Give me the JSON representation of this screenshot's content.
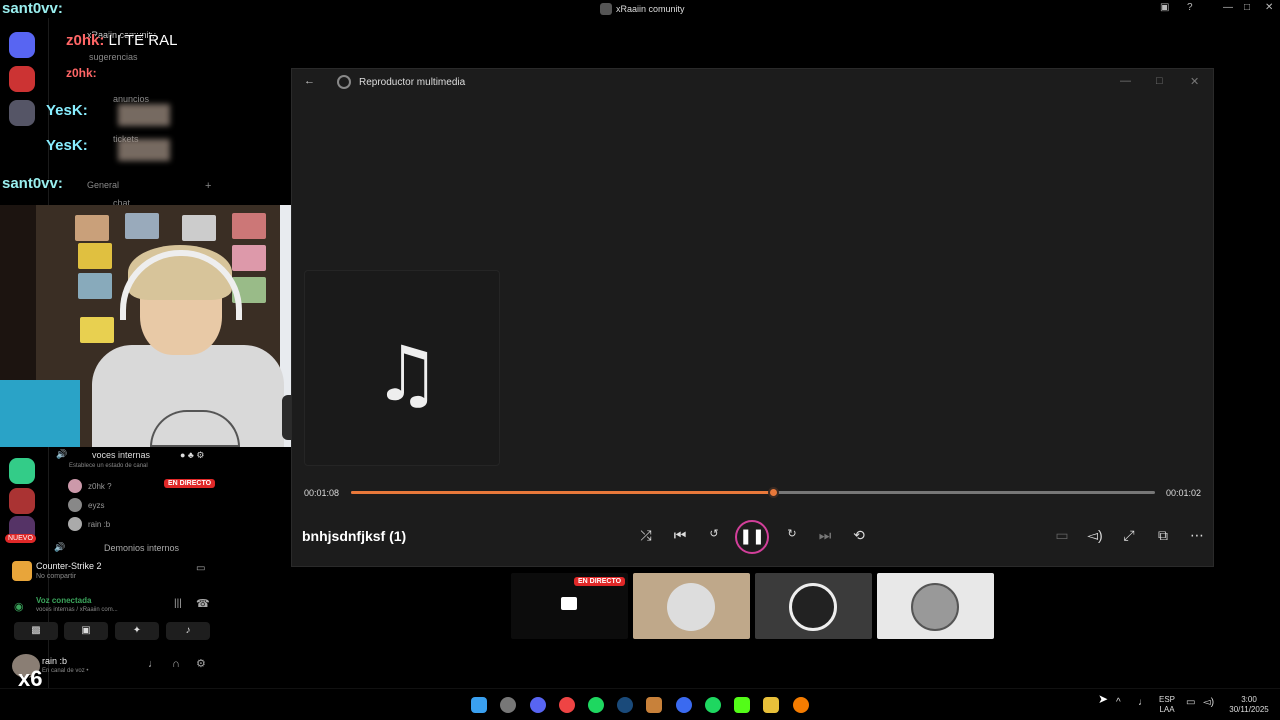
{
  "window": {
    "app_title": "xRaaiin comunity",
    "controls": [
      "—",
      "□",
      "✕"
    ]
  },
  "chat_overlay": [
    {
      "user": "sant0vv:",
      "message": "",
      "color": "#9ee"
    },
    {
      "user": "z0hk:",
      "message": "LI TE RAL",
      "color": "#f66"
    },
    {
      "user": "z0hk:",
      "message": "",
      "color": "#f66"
    },
    {
      "user": "YesK:",
      "message": "",
      "color": "#8ef"
    },
    {
      "user": "YesK:",
      "message": "",
      "color": "#8ef"
    },
    {
      "user": "sant0vv:",
      "message": "",
      "color": "#9ee"
    }
  ],
  "sidebar": {
    "server_name": "xRaaiin comunity",
    "channels": [
      "sugerencias",
      "anuncios",
      "tickets",
      "General",
      "chat"
    ],
    "voice_channel": {
      "name": "voces internas",
      "status_hint": "Establece un estado de canal",
      "users": [
        {
          "name": "z0hk ?",
          "live": true
        },
        {
          "name": "eyzs",
          "live": false
        },
        {
          "name": "rain :b",
          "live": false
        }
      ],
      "live_label": "EN DIRECTO"
    },
    "voice_channel_2": "Demonios internos",
    "new_badge": "NUEVO",
    "game": {
      "title": "Counter-Strike 2",
      "subtitle": "No compartir"
    },
    "voice_connected": {
      "title": "Voz conectada",
      "subtitle": "voces internas / xRaaiin com..."
    },
    "user": {
      "name": "rain :b",
      "status": "En canal de voz • ",
      "overlay": "x6"
    }
  },
  "player": {
    "title": "Reproductor multimedia",
    "track_name": "bnhjsdnfjksf (1)",
    "current_time": "00:01:08",
    "remaining_time": "00:01:02",
    "progress": 0.525,
    "note_icon": "music-note-icon"
  },
  "stream_tiles": {
    "live_label": "EN DIRECTO"
  },
  "taskbar": {
    "lang_top": "ESP",
    "lang_bottom": "LAA",
    "time": "3:00",
    "date": "30/11/2025"
  },
  "colors": {
    "accent_orange": "#e8783a",
    "play_ring": "#d23f9a",
    "live_red": "#e02828",
    "voice_green": "#3ba55c"
  }
}
